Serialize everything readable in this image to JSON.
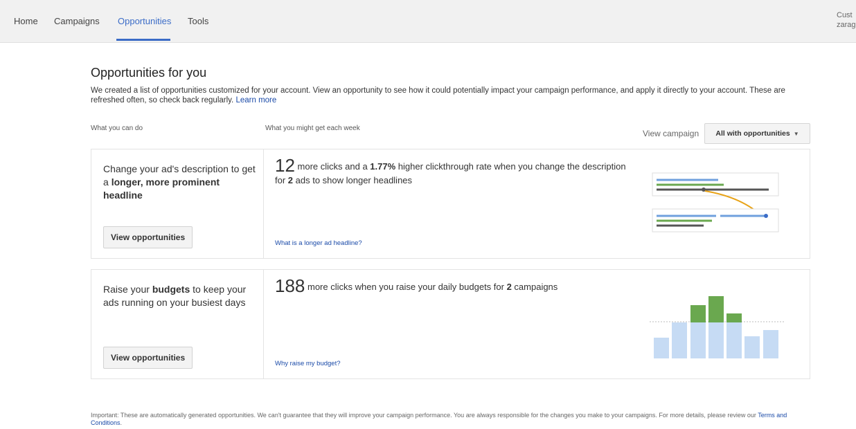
{
  "nav": {
    "tabs": [
      "Home",
      "Campaigns",
      "Opportunities",
      "Tools"
    ],
    "active_tab": "Opportunities",
    "account_line1": "Cust",
    "account_line2": "zarago"
  },
  "page": {
    "title": "Opportunities for you",
    "intro": "We created a list of opportunities customized for your account. View an opportunity to see how it could potentially impact your campaign performance, and apply it directly to your account. These are refreshed often, so check back regularly.",
    "learn_more": "Learn more"
  },
  "columns": {
    "what_you_can_do": "What you can do",
    "what_you_might_get": "What you might get each week"
  },
  "filter": {
    "label": "View campaign",
    "selected": "All with opportunities"
  },
  "cards": [
    {
      "desc_before": "Change your ad's description to get a ",
      "desc_bold": "longer, more prominent headline",
      "desc_after": "",
      "button": "View opportunities",
      "big_number": "12",
      "text_a": " more clicks and a ",
      "text_bold1": "1.77%",
      "text_b": " higher clickthrough rate when you change the description for ",
      "text_bold2": "2",
      "text_c": " ads to show longer headlines",
      "help_link": "What is a longer ad headline?",
      "illustration_icon": "headline-illustration-icon"
    },
    {
      "desc_before": "Raise your ",
      "desc_bold": "budgets",
      "desc_after": " to keep your ads running on your busiest days",
      "button": "View opportunities",
      "big_number": "188",
      "text_a": " more clicks when you raise your daily budgets for ",
      "text_bold1": "2",
      "text_b": " campaigns",
      "text_bold2": "",
      "text_c": "",
      "help_link": "Why raise my budget?",
      "illustration_icon": "budget-bar-chart-icon"
    }
  ],
  "footer": {
    "text": "Important: These are automatically generated opportunities. We can't guarantee that they will improve your campaign performance. You are always responsible for the changes you make to your campaigns. For more details, please review our",
    "link": "Terms and Conditions",
    "end": "."
  },
  "colors": {
    "accent": "#3b6cc7",
    "green": "#6aa84f",
    "light_blue": "#c6dbf4",
    "orange_arrow": "#e8a317"
  }
}
